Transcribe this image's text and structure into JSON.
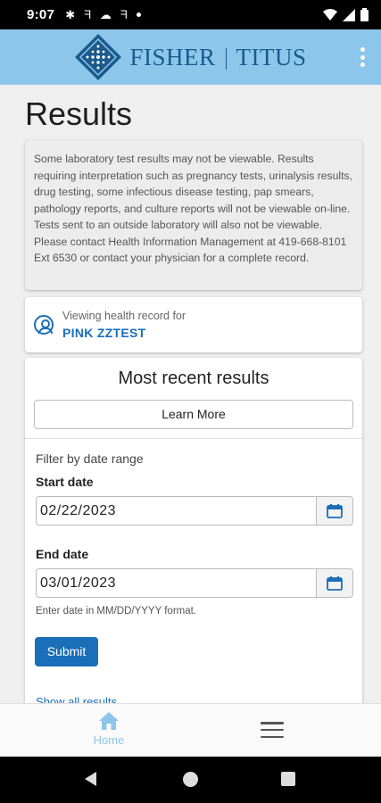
{
  "status_bar": {
    "time": "9:07"
  },
  "header": {
    "logo_left": "FISHER",
    "logo_right": "TITUS"
  },
  "page": {
    "title": "Results"
  },
  "notice": {
    "text": "Some laboratory test results may not be viewable. Results requiring interpretation such as pregnancy tests, urinalysis results, drug testing, some infectious disease testing, pap smears, pathology reports, and culture reports will not be viewable on-line. Tests sent to an outside laboratory will also not be viewable. Please contact Health Information Management at 419-668-8101 Ext 6530 or contact your physician for a complete record."
  },
  "record": {
    "label": "Viewing health record for",
    "name": "PINK ZZTEST"
  },
  "results": {
    "heading": "Most recent results",
    "learn_more": "Learn More",
    "filter_label": "Filter by date range",
    "start_label": "Start date",
    "start_value": "02/22/2023",
    "end_label": "End date",
    "end_value": "03/01/2023",
    "hint": "Enter date in MM/DD/YYYY format.",
    "submit": "Submit",
    "show_all": "Show all results"
  },
  "bottom_nav": {
    "home_label": "Home"
  },
  "colors": {
    "header_bg": "#8cc6ea",
    "accent": "#1a6fb8"
  }
}
